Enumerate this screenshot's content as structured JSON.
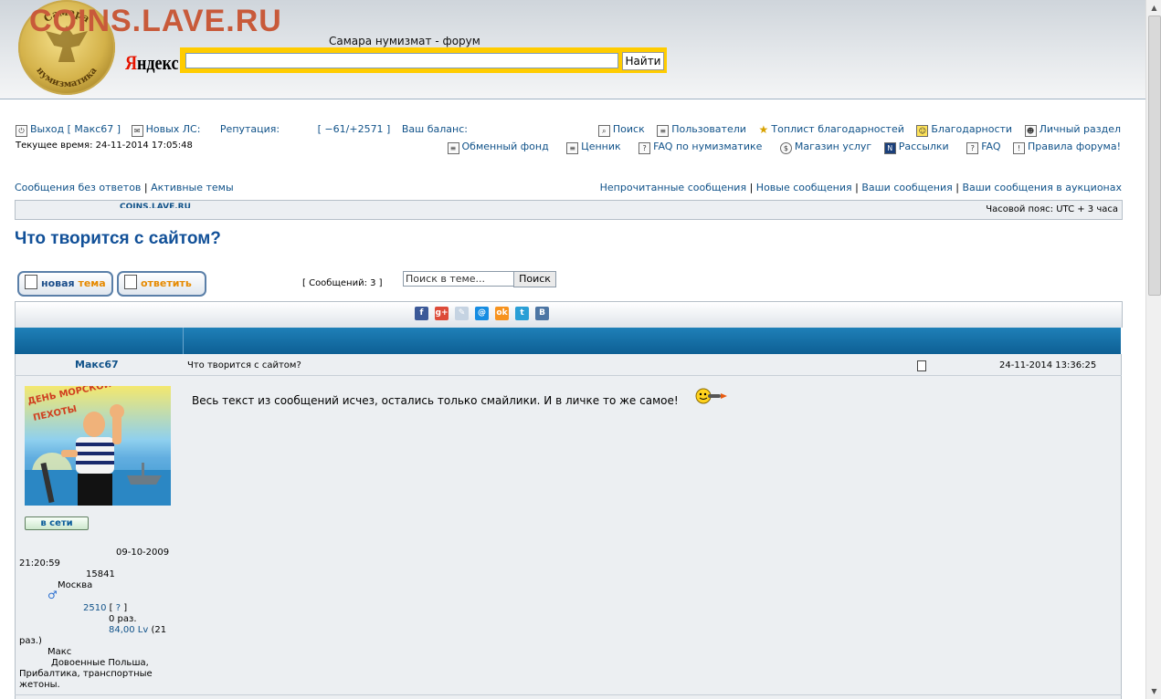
{
  "header": {
    "site_title": "COINS.LAVE.RU",
    "seal_top": "Самара",
    "seal_bottom": "нумизматика",
    "forum_name": "Самара нумизмат - форум",
    "yandex": {
      "logo_first": "Я",
      "logo_rest": "ндекс",
      "search_value": "",
      "button": "Найти"
    }
  },
  "user_nav": {
    "logout": "Выход [ Макс67 ]",
    "new_pm": "Новых ЛС:",
    "reputation_label": "Репутация:",
    "reputation_value": "[ −61/+2571 ]",
    "balance_label": "Ваш баланс:",
    "current_time": "Текущее время: 24-11-2014 17:05:48"
  },
  "main_nav": {
    "row1": [
      "Поиск",
      "Пользователи",
      "Топлист благодарностей",
      "Благодарности",
      "Личный раздел"
    ],
    "row2": [
      "Обменный фонд",
      "Ценник",
      "FAQ по нумизматике",
      "Магазин услуг",
      "Рассылки",
      "FAQ",
      "Правила форума!"
    ]
  },
  "quick_links": {
    "left": [
      "Сообщения без ответов",
      "Активные темы"
    ],
    "right": [
      "Непрочитанные сообщения",
      "Новые сообщения",
      "Ваши сообщения",
      "Ваши сообщения в аукционах"
    ],
    "separator": "|"
  },
  "info_bar": {
    "cut_text": "COINS.LAVE.RU",
    "timezone": "Часовой пояс: UTC + 3 часа"
  },
  "topic": {
    "title": "Что творится с сайтом?",
    "new_topic_first": "новая",
    "new_topic_second": " тема",
    "reply_button": "ответить",
    "post_count": "[ Сообщений: 3 ]",
    "search_placeholder": "Поиск в теме...",
    "search_button": "Поиск"
  },
  "share_icons": [
    {
      "name": "facebook-icon",
      "glyph": "f",
      "color": "#3b5998"
    },
    {
      "name": "google-plus-icon",
      "glyph": "g+",
      "color": "#dd4b39"
    },
    {
      "name": "livejournal-icon",
      "glyph": "✎",
      "color": "#c5d3e2"
    },
    {
      "name": "mailru-icon",
      "glyph": "@",
      "color": "#168de2"
    },
    {
      "name": "odnoklassniki-icon",
      "glyph": "ok",
      "color": "#f7931e"
    },
    {
      "name": "twitter-icon",
      "glyph": "t",
      "color": "#2a9fd6"
    },
    {
      "name": "vkontakte-icon",
      "glyph": "B",
      "color": "#4c75a3"
    }
  ],
  "post": {
    "author": "Макс67",
    "subject": "Что творится с сайтом?",
    "date": "24-11-2014 13:36:25",
    "body": "Весь текст из сообщений исчез, остались только смайлики. И в личке то же самое!",
    "avatar_caption_1": "ДЕНЬ МОРСКОЙ",
    "avatar_caption_2": "ПЕХОТЫ",
    "online_badge": "в сети",
    "profile": {
      "registered_date": "09-10-2009",
      "registered_time": "21:20:59",
      "posts": "15841",
      "city": "Москва",
      "gender_symbol": "♂",
      "rep_value": "2510",
      "rep_bracket_open": "[",
      "rep_link": "?",
      "rep_bracket_close": "]",
      "thanks": "0 раз.",
      "balance": "84,00 Lv",
      "balance_note": "(21",
      "balance_note_2": "раз.)",
      "name": "Макс",
      "interests_1": "Довоенные Польша,",
      "interests_2": "Прибалтика, транспортные",
      "interests_3": "жетоны."
    }
  }
}
